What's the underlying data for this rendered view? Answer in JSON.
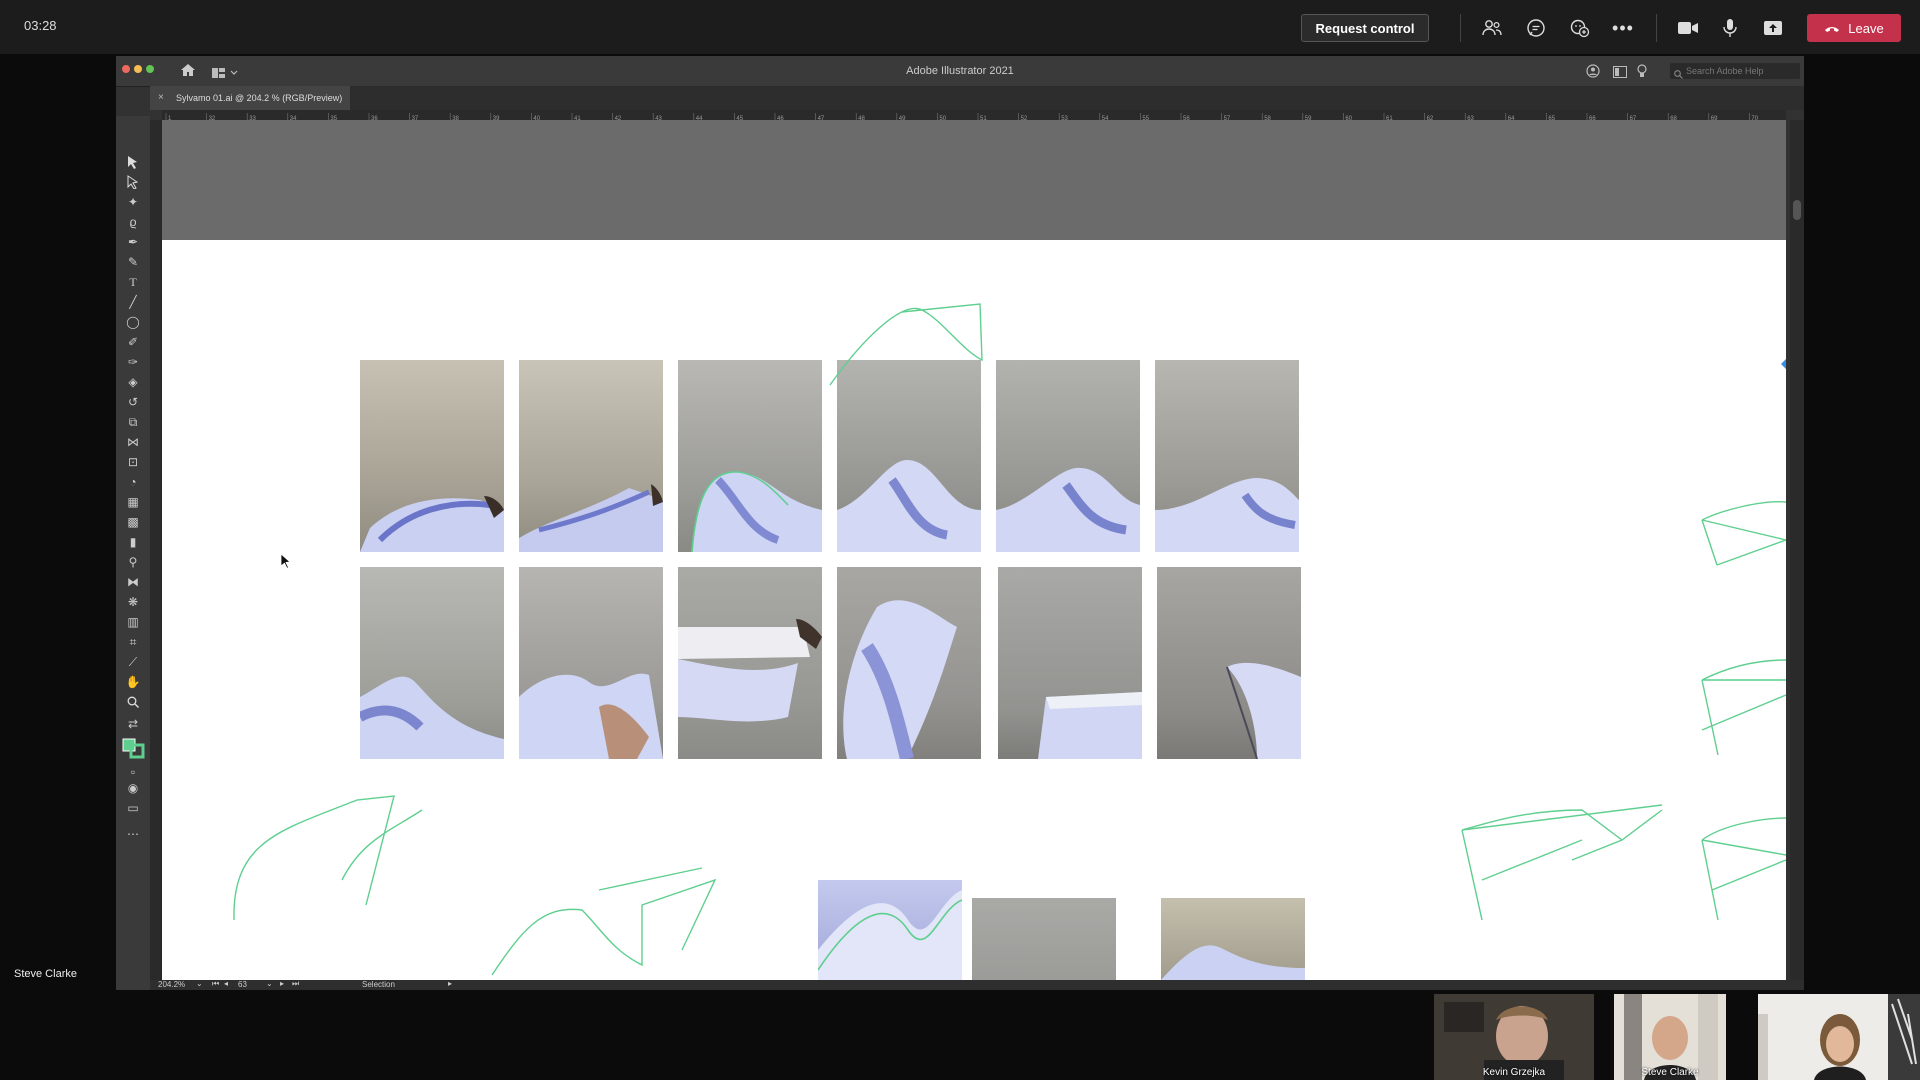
{
  "meeting": {
    "time": "03:28",
    "request_control_label": "Request control",
    "leave_label": "Leave",
    "presenter_name": "Steve Clarke",
    "toolbar_icons": [
      "people-icon",
      "chat-icon",
      "reactions-icon",
      "more-icon",
      "camera-icon",
      "microphone-icon",
      "share-icon"
    ],
    "participants": [
      {
        "name": "Kevin Grzejka"
      },
      {
        "name": "Steve Clarke"
      },
      {
        "name": ""
      }
    ]
  },
  "illustrator": {
    "app_title": "Adobe Illustrator 2021",
    "search_placeholder": "Search Adobe Help",
    "document_tab": "Sylvamo 01.ai @ 204.2 % (RGB/Preview)",
    "zoom": "204.2%",
    "artboard_number": "63",
    "status_tool": "Selection",
    "ruler_ticks": [
      "1",
      "32",
      "33",
      "34",
      "35",
      "36",
      "37",
      "38",
      "39",
      "40",
      "41",
      "42",
      "43",
      "44",
      "45",
      "46",
      "47",
      "48",
      "49",
      "50",
      "51",
      "52",
      "53",
      "54",
      "55",
      "56",
      "57",
      "58",
      "59",
      "60",
      "61",
      "62",
      "63",
      "64",
      "65",
      "66",
      "67",
      "68",
      "69",
      "70"
    ]
  },
  "colors": {
    "leave_red": "#c4314b",
    "sketch_green": "#5fcf8f",
    "ai_dark": "#323232",
    "pasteboard": "#6b6b6b"
  }
}
